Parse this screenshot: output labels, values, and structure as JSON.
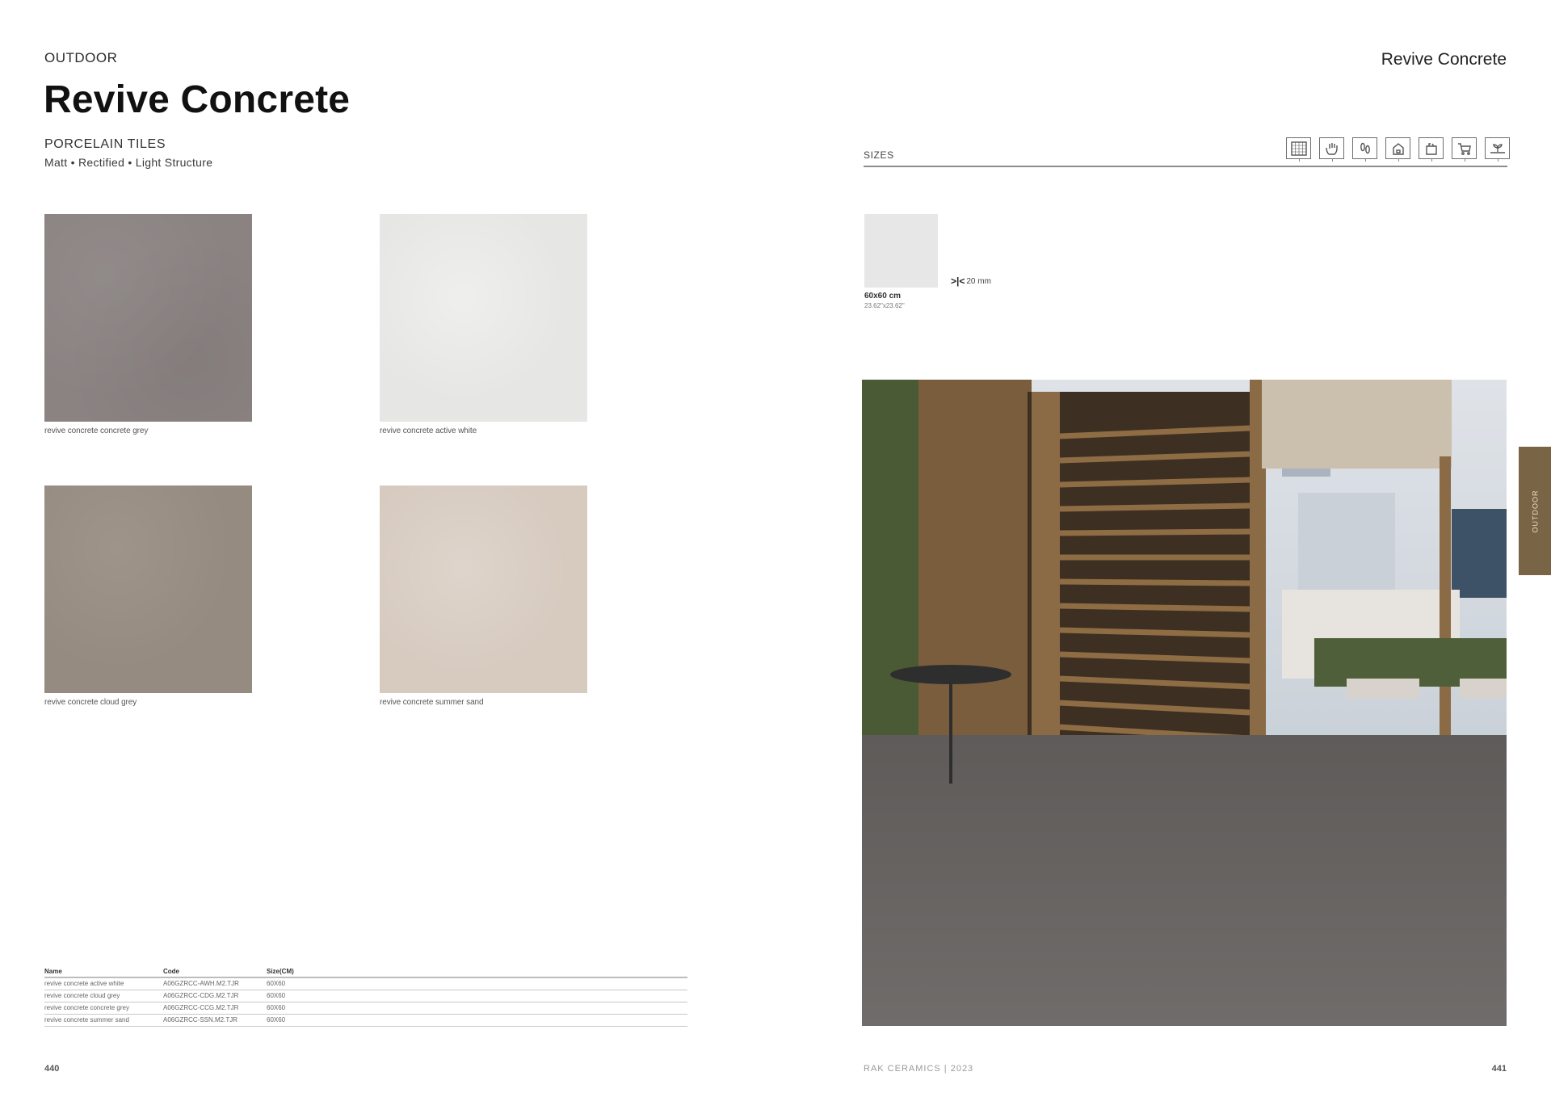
{
  "left_page": {
    "section": "OUTDOOR",
    "title": "Revive Concrete",
    "subtitle": "PORCELAIN TILES",
    "features": "Matt • Rectified • Light Structure",
    "tiles": [
      {
        "caption": "revive concrete concrete grey",
        "color": "#8a8382"
      },
      {
        "caption": "revive concrete active white",
        "color": "#e6e6e4"
      },
      {
        "caption": "revive concrete cloud grey",
        "color": "#968b80"
      },
      {
        "caption": "revive concrete summer sand",
        "color": "#d7cbc0"
      }
    ],
    "table": {
      "headers": [
        "Name",
        "Code",
        "Size(CM)"
      ],
      "rows": [
        [
          "revive concrete active white",
          "A06GZRCC-AWH.M2.TJR",
          "60X60"
        ],
        [
          "revive concrete cloud grey",
          "A06GZRCC-CDG.M2.TJR",
          "60X60"
        ],
        [
          "revive concrete concrete grey",
          "A06GZRCC-CCG.M2.TJR",
          "60X60"
        ],
        [
          "revive concrete summer sand",
          "A06GZRCC-SSN.M2.TJR",
          "60X60"
        ]
      ]
    },
    "page_number": "440"
  },
  "right_page": {
    "running_head": "Revive Concrete",
    "sizes_label": "SIZES",
    "usage_icons": [
      "tile-grid-icon",
      "hand-icon",
      "footprints-icon",
      "house-icon",
      "shopping-bag-icon",
      "shopping-cart-icon",
      "outdoor-plant-icon"
    ],
    "size": {
      "swatch_color": "#e7e7e7",
      "label_cm": "60x60 cm",
      "label_in": "23.62\"x23.62\"",
      "thickness_glyph": ">|<",
      "thickness": "20 mm"
    },
    "footer_brand": "RAK CERAMICS | 2023",
    "page_number": "441",
    "side_tab": "OUTDOOR",
    "accent_color": "#7a6446"
  }
}
